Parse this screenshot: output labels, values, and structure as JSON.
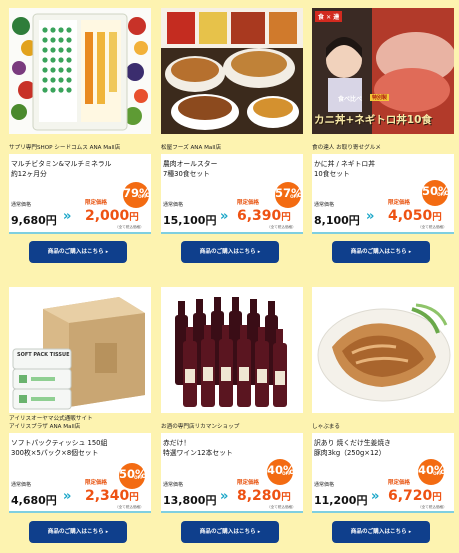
{
  "labels": {
    "normal_price": "通常価格",
    "limited_price": "限定価格",
    "tax_note": "（全て税込価格）",
    "off": "OFF",
    "buy_button": "商品のご購入はこちら"
  },
  "colors": {
    "background": "#fdf3b0",
    "badge": "#f36b12",
    "sale_price": "#ee5213",
    "chevron": "#1aa6c8",
    "button": "#0f3f8c",
    "divider": "#7fcfe0"
  },
  "products": [
    {
      "shop": "サプリ専門SHOP シードコムス ANA Mall店",
      "name_line1": "マルチビタミン&マルチミネラル",
      "name_line2": "約12ヶ月分",
      "discount": "79%",
      "normal_price": "9,680円",
      "sale_number": "2,000",
      "sale_unit": "円",
      "image": "supplement-box-and-vegetables-photo"
    },
    {
      "shop": "松屋フーズ ANA Mall店",
      "name_line1": "農肉オールスター",
      "name_line2": "7種30食セット",
      "discount": "57%",
      "normal_price": "15,100円",
      "sale_number": "6,390",
      "sale_unit": "円",
      "image": "gyudon-bowls-photo"
    },
    {
      "shop": "食の達人 お取り寄せグルメ",
      "name_line1": "かに丼 / ネギトロ丼",
      "name_line2": "10食セット",
      "discount": "50%",
      "normal_price": "8,100円",
      "sale_number": "4,050",
      "sale_unit": "円",
      "image": "crab-negitoro-don-photo",
      "image_text": {
        "corner_tag": "食 ✕ 達",
        "caption_top": "食べ比べ",
        "caption_tag": "特別製",
        "caption_main": "カニ丼+ネギトロ丼10食"
      }
    },
    {
      "shop_line1": "アイリスオーヤマ公式通販サイト",
      "shop_line2": "アイリスプラザ ANA Mall店",
      "name_line1": "ソフトパックティッシュ 150組",
      "name_line2": "300枚×5パック×8個セット",
      "discount": "50%",
      "normal_price": "4,680円",
      "sale_number": "2,340",
      "sale_unit": "円",
      "image": "soft-pack-tissue-carton-photo",
      "image_text": {
        "box_label": "SOFT PACK TISSUE"
      }
    },
    {
      "shop": "お酒の専門店リカマンショップ",
      "name_line1": "赤だけ！",
      "name_line2": "特選ワイン12本セット",
      "discount": "40%",
      "normal_price": "13,800円",
      "sale_number": "8,280",
      "sale_unit": "円",
      "image": "red-wine-bottles-photo"
    },
    {
      "shop": "しゃぶまる",
      "name_line1": "訳あり 焼くだけ生姜焼き",
      "name_line2": "豚肉3kg（250g×12）",
      "discount": "40%",
      "normal_price": "11,200円",
      "sale_number": "6,720",
      "sale_unit": "円",
      "image": "ginger-pork-dish-photo"
    }
  ]
}
